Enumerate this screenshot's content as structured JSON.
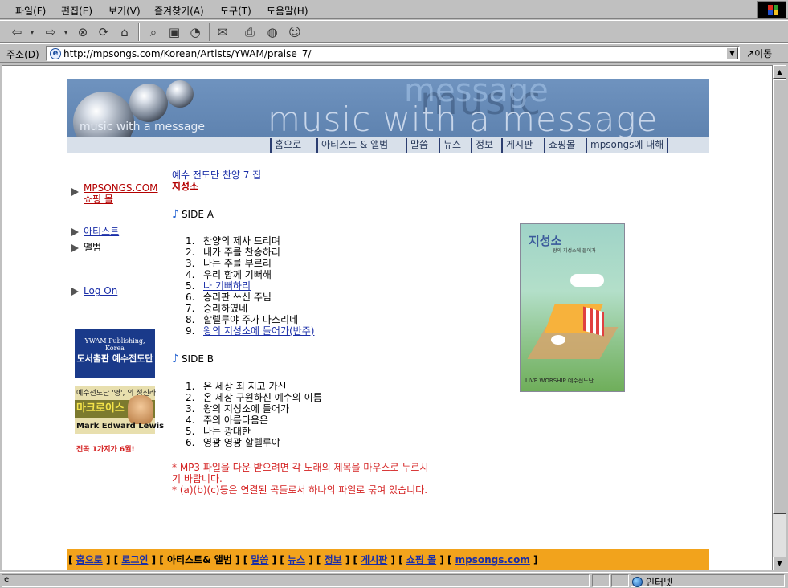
{
  "browser": {
    "menu": [
      "파일(F)",
      "편집(E)",
      "보기(V)",
      "즐겨찾기(A)",
      "도구(T)",
      "도움말(H)"
    ],
    "address_label": "주소(D)",
    "url": "http://mpsongs.com/Korean/Artists/YWAM/praise_7/",
    "go_label": "이동",
    "zone": "인터넷"
  },
  "banner": {
    "bg_word_1": "music",
    "bg_word_2": "message",
    "big_text": "music with a message",
    "small_text": "music with a message",
    "nav": [
      "홈으로",
      "아티스트 & 앨범",
      "말씀",
      "뉴스",
      "정보",
      "게시판",
      "쇼핑몰",
      "mpsongs에 대해"
    ]
  },
  "sidebar": {
    "shop_line1": "MPSONGS.COM",
    "shop_line2": "쇼핑 몰",
    "artists": "아티스트",
    "albums": "앨범",
    "logon": "Log On"
  },
  "ads": {
    "ad1_line1": "YWAM Publishing, Korea",
    "ad1_line2": "도서출판 예수전도단",
    "ad2_line1": "예수전도단 '영', 의 정신라",
    "ad2_line2": "마크로이스",
    "ad2_line3": "Mark Edward Lewis",
    "ad_note": "전곡 1가지가 6월!"
  },
  "album": {
    "series": "예수 전도단 찬양 7 집",
    "title": "지성소",
    "side_a_label": "SIDE A",
    "side_a": [
      {
        "num": "1.",
        "title": "찬양의 제사 드리며",
        "link": false
      },
      {
        "num": "2.",
        "title": "내가 주를 찬송하리",
        "link": false
      },
      {
        "num": "3.",
        "title": "나는 주를 부르리",
        "link": false
      },
      {
        "num": "4.",
        "title": "우리 함께 기뻐해",
        "link": false
      },
      {
        "num": "5.",
        "title": "나 기뻐하리",
        "link": true
      },
      {
        "num": "6.",
        "title": "승리판 쓰신 주님",
        "link": false
      },
      {
        "num": "7.",
        "title": "승리하였네",
        "link": false
      },
      {
        "num": "8.",
        "title": "할렐루야 주가 다스리네",
        "link": false
      },
      {
        "num": "9.",
        "title": "왕의 지성소에 들어가(반주)",
        "link": true
      }
    ],
    "side_b_label": "SIDE B",
    "side_b": [
      {
        "num": "1.",
        "title": "온 세상 죄 지고 가신",
        "link": false
      },
      {
        "num": "2.",
        "title": "온 세상 구원하신 예수의 이름",
        "link": false
      },
      {
        "num": "3.",
        "title": "왕의 지성소에 들어가",
        "link": false
      },
      {
        "num": "4.",
        "title": "주의 아름다움은",
        "link": false
      },
      {
        "num": "5.",
        "title": "나는 광대한",
        "link": false
      },
      {
        "num": "6.",
        "title": "영광 영광 할렐루야",
        "link": false
      }
    ],
    "note1": "* MP3 파일을 다운 받으려면 각 노래의 제목을 마우스로 누르시기 바랍니다.",
    "note2": "* (a)(b)(c)등은 연결된 곡들로서 하나의 파일로 묶여 있습니다.",
    "cover_title": "지성소",
    "cover_subtitle": "왕의 지성소에 들어가",
    "cover_footer": "LIVE WORSHIP 예수전도단"
  },
  "footer": {
    "links": [
      "홈으로",
      "로그인",
      "아티스트& 앨범",
      "말씀",
      "뉴스",
      "정보",
      "게시판",
      "쇼핑 몰",
      "mpsongs.com"
    ],
    "linked": [
      true,
      true,
      false,
      true,
      true,
      true,
      true,
      true,
      true
    ]
  },
  "colors": {
    "link": "#1a2ea8",
    "red": "#b30000",
    "banner": "#6f93bf",
    "footer": "#f2a31c"
  }
}
